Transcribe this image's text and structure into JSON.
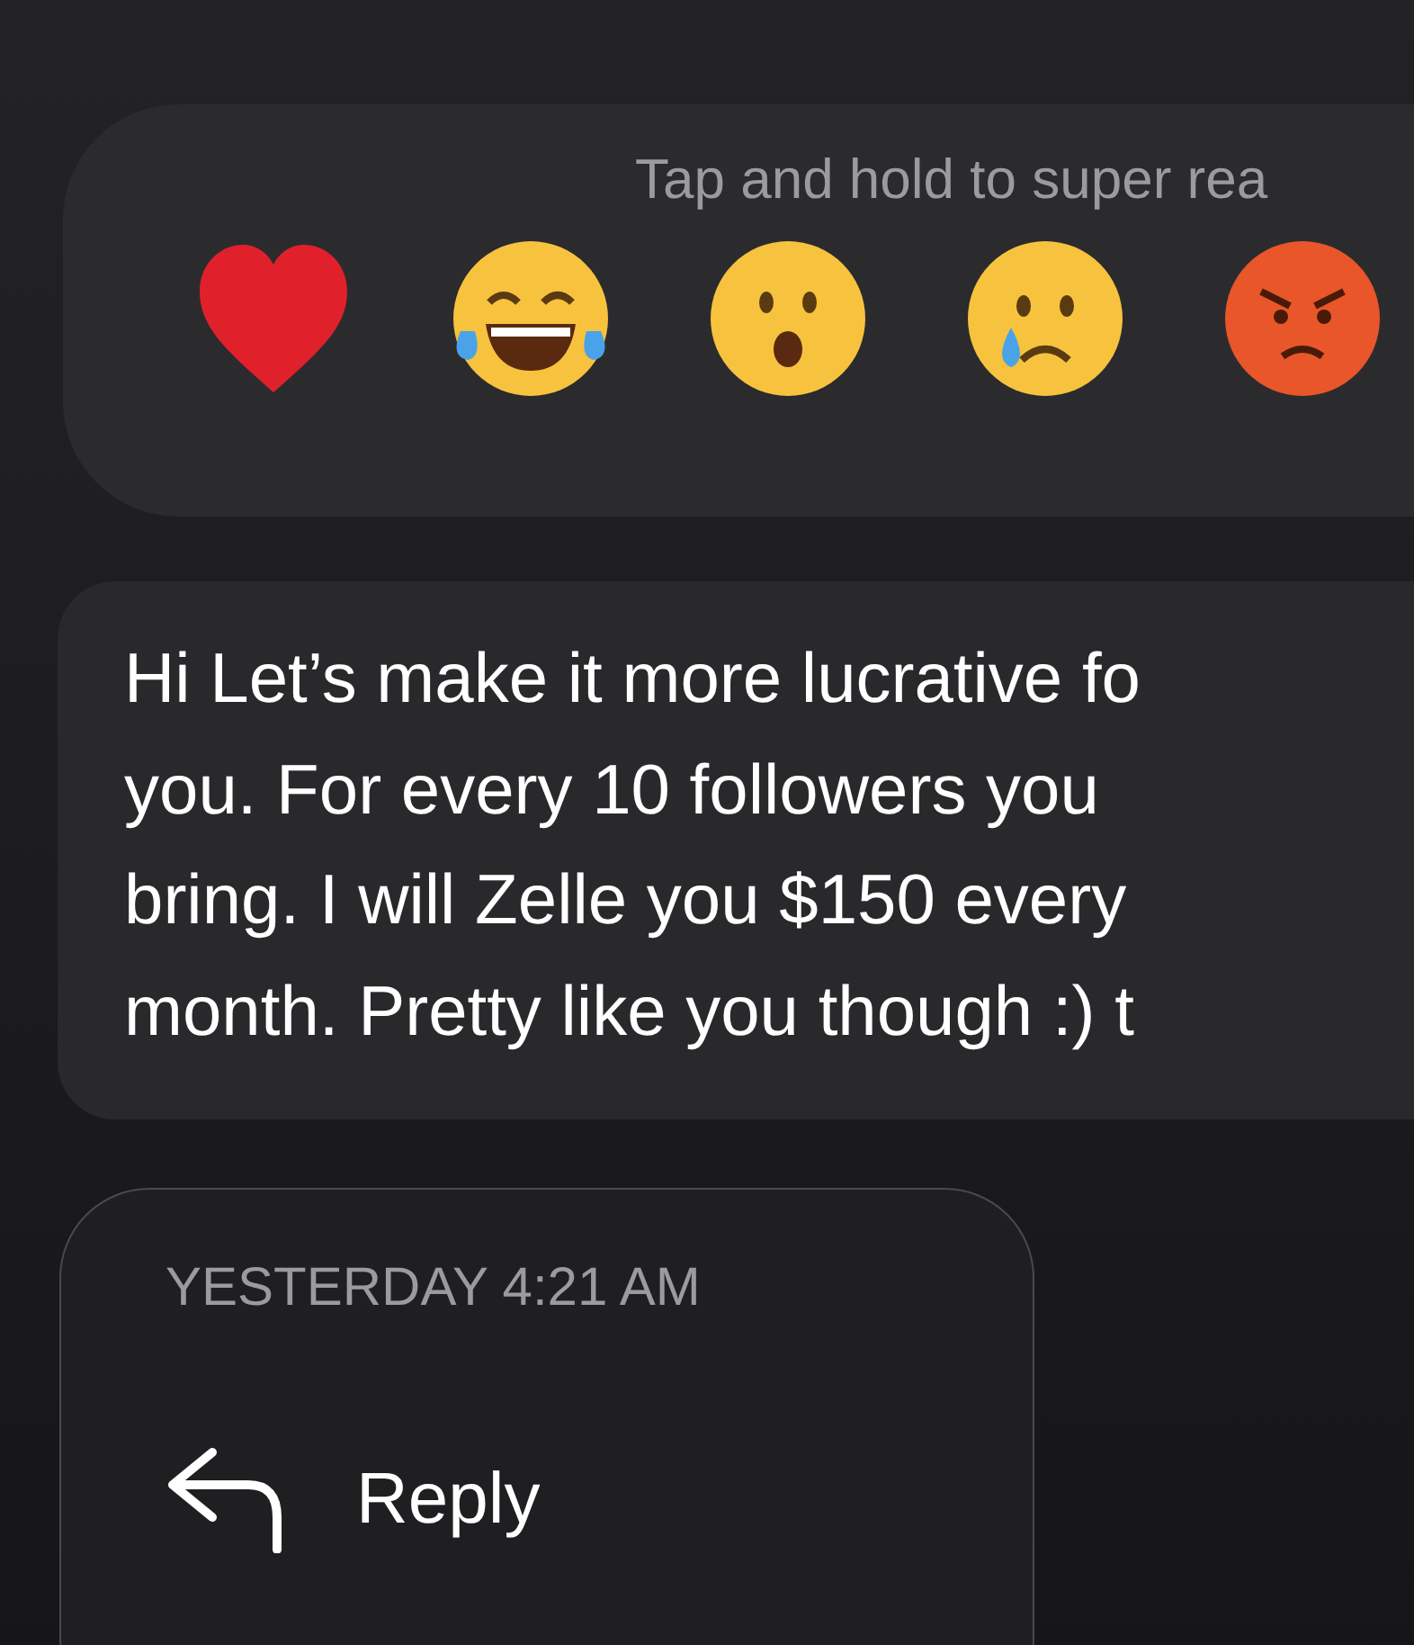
{
  "reaction_bar": {
    "hint": "Tap and hold to super rea",
    "reactions": [
      {
        "kind": "heart"
      },
      {
        "kind": "laughing"
      },
      {
        "kind": "surprised"
      },
      {
        "kind": "crying"
      },
      {
        "kind": "angry"
      }
    ]
  },
  "message": {
    "lines": [
      "Hi Let’s make it more lucrative fo",
      "you. For every 10 followers you",
      "bring. I will Zelle you $150 every",
      "month. Pretty like you though :) t"
    ]
  },
  "menu": {
    "timestamp": "YESTERDAY 4:21 AM",
    "actions": [
      {
        "kind": "reply",
        "label": "Reply"
      }
    ]
  }
}
